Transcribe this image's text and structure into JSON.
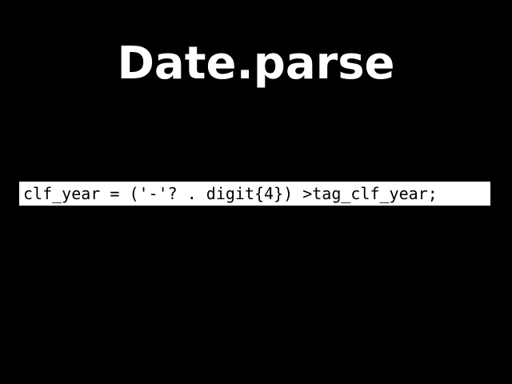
{
  "slide": {
    "title": "Date.parse",
    "code": "clf_year = ('-'? . digit{4}) >tag_clf_year;"
  },
  "colors": {
    "background": "#000000",
    "title": "#ffffff",
    "code_box": "#ffffff",
    "code_text": "#000000"
  }
}
